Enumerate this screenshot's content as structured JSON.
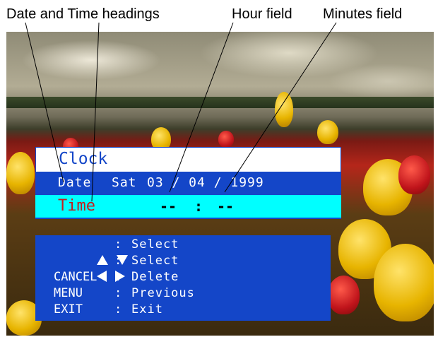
{
  "callouts": {
    "date_time_headings": "Date and Time headings",
    "hour_field": "Hour field",
    "minutes_field": "Minutes field"
  },
  "clock_menu": {
    "title": "Clock",
    "date_label": "Date",
    "date_day": "Sat",
    "date_value": "03 / 04 / 1999",
    "time_label": "Time",
    "time_hour": "--",
    "time_separator": ":",
    "time_minutes": "--"
  },
  "help": [
    {
      "keys": [
        "up-arrow-icon",
        "down-arrow-icon"
      ],
      "key_label": "",
      "action": "Select"
    },
    {
      "keys": [
        "left-arrow-icon",
        "right-arrow-icon"
      ],
      "key_label": "",
      "action": "Select"
    },
    {
      "keys": [],
      "key_label": "CANCEL",
      "action": "Delete"
    },
    {
      "keys": [],
      "key_label": "MENU",
      "action": "Previous"
    },
    {
      "keys": [],
      "key_label": "EXIT",
      "action": "Exit"
    }
  ],
  "colors": {
    "osd_blue": "#1446c8",
    "highlight_cyan": "#00ffff",
    "time_label_red": "#c41e1e",
    "title_background": "#ffffff"
  },
  "background": "tulip-field-photo"
}
